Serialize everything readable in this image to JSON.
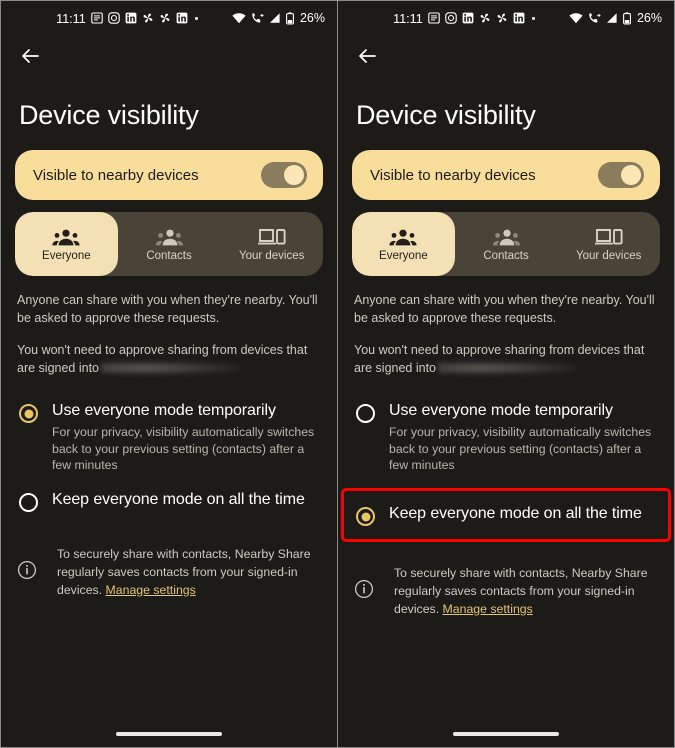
{
  "status_bar": {
    "time": "11:11",
    "left_icons": [
      "messages-icon",
      "instagram-icon",
      "linkedin-icon",
      "pinwheel-icon",
      "pinwheel-icon",
      "linkedin-icon",
      "overflow-dot-icon"
    ],
    "right_icons": [
      "wifi-icon",
      "call-forward-icon",
      "signal-icon",
      "battery-icon"
    ],
    "battery_label": "26%"
  },
  "nav": {
    "back_label": "Back"
  },
  "page": {
    "title": "Device visibility"
  },
  "visibility_card": {
    "label": "Visible to nearby devices",
    "toggle_state": "on"
  },
  "segmented": {
    "items": [
      {
        "label": "Everyone",
        "icon": "group-people-icon",
        "selected": true
      },
      {
        "label": "Contacts",
        "icon": "two-people-icon",
        "selected": false
      },
      {
        "label": "Your devices",
        "icon": "laptop-phone-icon",
        "selected": false
      }
    ]
  },
  "description": {
    "paragraph_1": "Anyone can share with you when they're nearby. You'll be asked to approve these requests.",
    "paragraph_2_prefix": "You won't need to approve sharing from devices that are signed into",
    "paragraph_2_redacted": true
  },
  "options": [
    {
      "title": "Use everyone mode temporarily",
      "description": "For your privacy, visibility automatically switches back to your previous setting (contacts) after a few minutes"
    },
    {
      "title": "Keep everyone mode on all the time",
      "description": ""
    }
  ],
  "footer": {
    "icon": "info-icon",
    "text": "To securely share with contacts, Nearby Share regularly saves contacts from your signed-in devices. ",
    "link_label": "Manage settings"
  },
  "panels": [
    {
      "name": "left-panel",
      "selected_option_index": 0,
      "highlight_option_index": -1
    },
    {
      "name": "right-panel",
      "selected_option_index": 1,
      "highlight_option_index": 1
    }
  ],
  "colors": {
    "background": "#1c1b18",
    "card_amber": "#f9dd9b",
    "segment_track": "#4a4338",
    "segment_active": "#f3e0b4",
    "accent_amber": "#e9c469",
    "link_amber": "#e2c374",
    "highlight_red": "#ff0000"
  }
}
